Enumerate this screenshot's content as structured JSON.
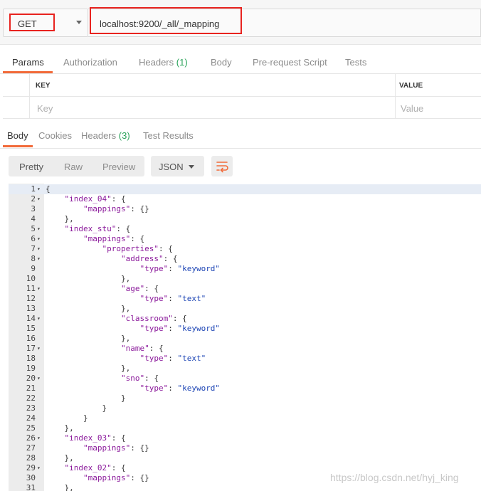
{
  "request": {
    "method": "GET",
    "url": "localhost:9200/_all/_mapping"
  },
  "request_tabs": [
    {
      "label": "Params",
      "count": ""
    },
    {
      "label": "Authorization",
      "count": ""
    },
    {
      "label": "Headers",
      "count": "(1)"
    },
    {
      "label": "Body",
      "count": ""
    },
    {
      "label": "Pre-request Script",
      "count": ""
    },
    {
      "label": "Tests",
      "count": ""
    }
  ],
  "params": {
    "key_header": "KEY",
    "value_header": "VALUE",
    "key_placeholder": "Key",
    "value_placeholder": "Value"
  },
  "response_tabs": [
    {
      "label": "Body",
      "count": ""
    },
    {
      "label": "Cookies",
      "count": ""
    },
    {
      "label": "Headers",
      "count": "(3)"
    },
    {
      "label": "Test Results",
      "count": ""
    }
  ],
  "view_modes": [
    "Pretty",
    "Raw",
    "Preview"
  ],
  "format": "JSON",
  "icons": {
    "wrap": "wrap-lines-icon",
    "caret": "chevron-down-icon",
    "fold": "fold-arrow-icon"
  },
  "colors": {
    "accent": "#f26b3a",
    "highlight": "#e8231f",
    "count": "#2aa35a"
  },
  "code_lines": [
    {
      "n": "1",
      "fold": true,
      "text": "{"
    },
    {
      "n": "2",
      "fold": true,
      "text": "    \"index_04\": {"
    },
    {
      "n": "3",
      "fold": false,
      "text": "        \"mappings\": {}"
    },
    {
      "n": "4",
      "fold": false,
      "text": "    },"
    },
    {
      "n": "5",
      "fold": true,
      "text": "    \"index_stu\": {"
    },
    {
      "n": "6",
      "fold": true,
      "text": "        \"mappings\": {"
    },
    {
      "n": "7",
      "fold": true,
      "text": "            \"properties\": {"
    },
    {
      "n": "8",
      "fold": true,
      "text": "                \"address\": {"
    },
    {
      "n": "9",
      "fold": false,
      "text": "                    \"type\": \"keyword\""
    },
    {
      "n": "10",
      "fold": false,
      "text": "                },"
    },
    {
      "n": "11",
      "fold": true,
      "text": "                \"age\": {"
    },
    {
      "n": "12",
      "fold": false,
      "text": "                    \"type\": \"text\""
    },
    {
      "n": "13",
      "fold": false,
      "text": "                },"
    },
    {
      "n": "14",
      "fold": true,
      "text": "                \"classroom\": {"
    },
    {
      "n": "15",
      "fold": false,
      "text": "                    \"type\": \"keyword\""
    },
    {
      "n": "16",
      "fold": false,
      "text": "                },"
    },
    {
      "n": "17",
      "fold": true,
      "text": "                \"name\": {"
    },
    {
      "n": "18",
      "fold": false,
      "text": "                    \"type\": \"text\""
    },
    {
      "n": "19",
      "fold": false,
      "text": "                },"
    },
    {
      "n": "20",
      "fold": true,
      "text": "                \"sno\": {"
    },
    {
      "n": "21",
      "fold": false,
      "text": "                    \"type\": \"keyword\""
    },
    {
      "n": "22",
      "fold": false,
      "text": "                }"
    },
    {
      "n": "23",
      "fold": false,
      "text": "            }"
    },
    {
      "n": "24",
      "fold": false,
      "text": "        }"
    },
    {
      "n": "25",
      "fold": false,
      "text": "    },"
    },
    {
      "n": "26",
      "fold": true,
      "text": "    \"index_03\": {"
    },
    {
      "n": "27",
      "fold": false,
      "text": "        \"mappings\": {}"
    },
    {
      "n": "28",
      "fold": false,
      "text": "    },"
    },
    {
      "n": "29",
      "fold": true,
      "text": "    \"index_02\": {"
    },
    {
      "n": "30",
      "fold": false,
      "text": "        \"mappings\": {}"
    },
    {
      "n": "31",
      "fold": false,
      "text": "    },"
    }
  ],
  "watermark": "https://blog.csdn.net/hyj_king"
}
